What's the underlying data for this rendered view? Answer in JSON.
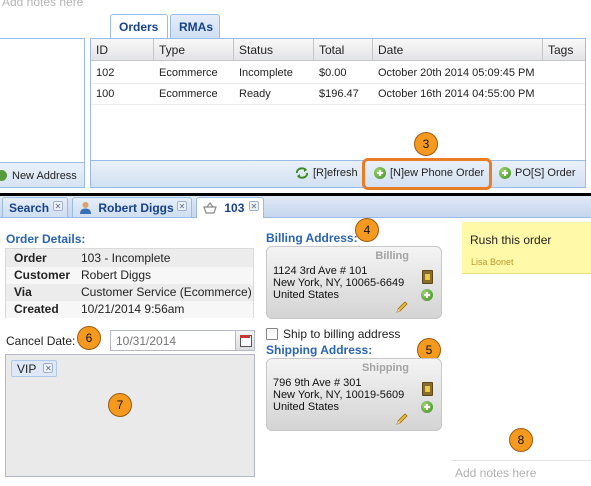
{
  "top": {
    "notes_placeholder": "Add notes here",
    "new_address_label": "New Address",
    "tabs": [
      {
        "label": "Orders",
        "active": true
      },
      {
        "label": "RMAs",
        "active": false
      }
    ],
    "grid": {
      "columns": [
        "ID",
        "Type",
        "Status",
        "Total",
        "Date",
        "Tags"
      ],
      "rows": [
        {
          "id": "102",
          "type": "Ecommerce",
          "status": "Incomplete",
          "total": "$0.00",
          "date": "October 20th 2014 05:09:45 PM",
          "tags": ""
        },
        {
          "id": "100",
          "type": "Ecommerce",
          "status": "Ready",
          "total": "$196.47",
          "date": "October 16th 2014 04:55:00 PM",
          "tags": ""
        }
      ]
    },
    "toolbar": {
      "refresh_label": "[R]efresh",
      "new_phone_order_label": "[N]ew Phone Order",
      "pos_order_label": "PO[S] Order"
    }
  },
  "bottom": {
    "tabs": [
      {
        "label": "Search"
      },
      {
        "label": "Robert Diggs"
      },
      {
        "label": "103"
      }
    ],
    "order_details_title": "Order Details:",
    "details": [
      {
        "key": "Order",
        "value": "103 - Incomplete"
      },
      {
        "key": "Customer",
        "value": "Robert Diggs"
      },
      {
        "key": "Via",
        "value": "Customer Service (Ecommerce)"
      },
      {
        "key": "Created",
        "value": "10/21/2014 9:56am"
      }
    ],
    "cancel_date_label": "Cancel Date:",
    "cancel_date_placeholder": "10/31/2014",
    "tags": [
      "VIP"
    ],
    "billing_title": "Billing Address:",
    "billing": {
      "tag": "Billing",
      "line1": "1124 3rd Ave # 101",
      "line2": "New York, NY, 10065-6649",
      "line3": "United States"
    },
    "ship_to_billing_label": "Ship to billing address",
    "shipping_title": "Shipping Address:",
    "shipping": {
      "tag": "Shipping",
      "line1": "796 9th Ave # 301",
      "line2": "New York, NY, 10019-5609",
      "line3": "United States"
    },
    "sticky_note": {
      "text": "Rush this order",
      "author": "Lisa Bonet"
    },
    "notes_placeholder": "Add notes here"
  },
  "callouts": [
    "3",
    "4",
    "5",
    "6",
    "7",
    "8"
  ],
  "colors": {
    "accent_blue": "#15428b",
    "section_blue": "#2a64b5",
    "highlight_orange": "#e97c25",
    "badge_orange": "#f59a1f",
    "sticky_yellow": "#fff9a8"
  }
}
